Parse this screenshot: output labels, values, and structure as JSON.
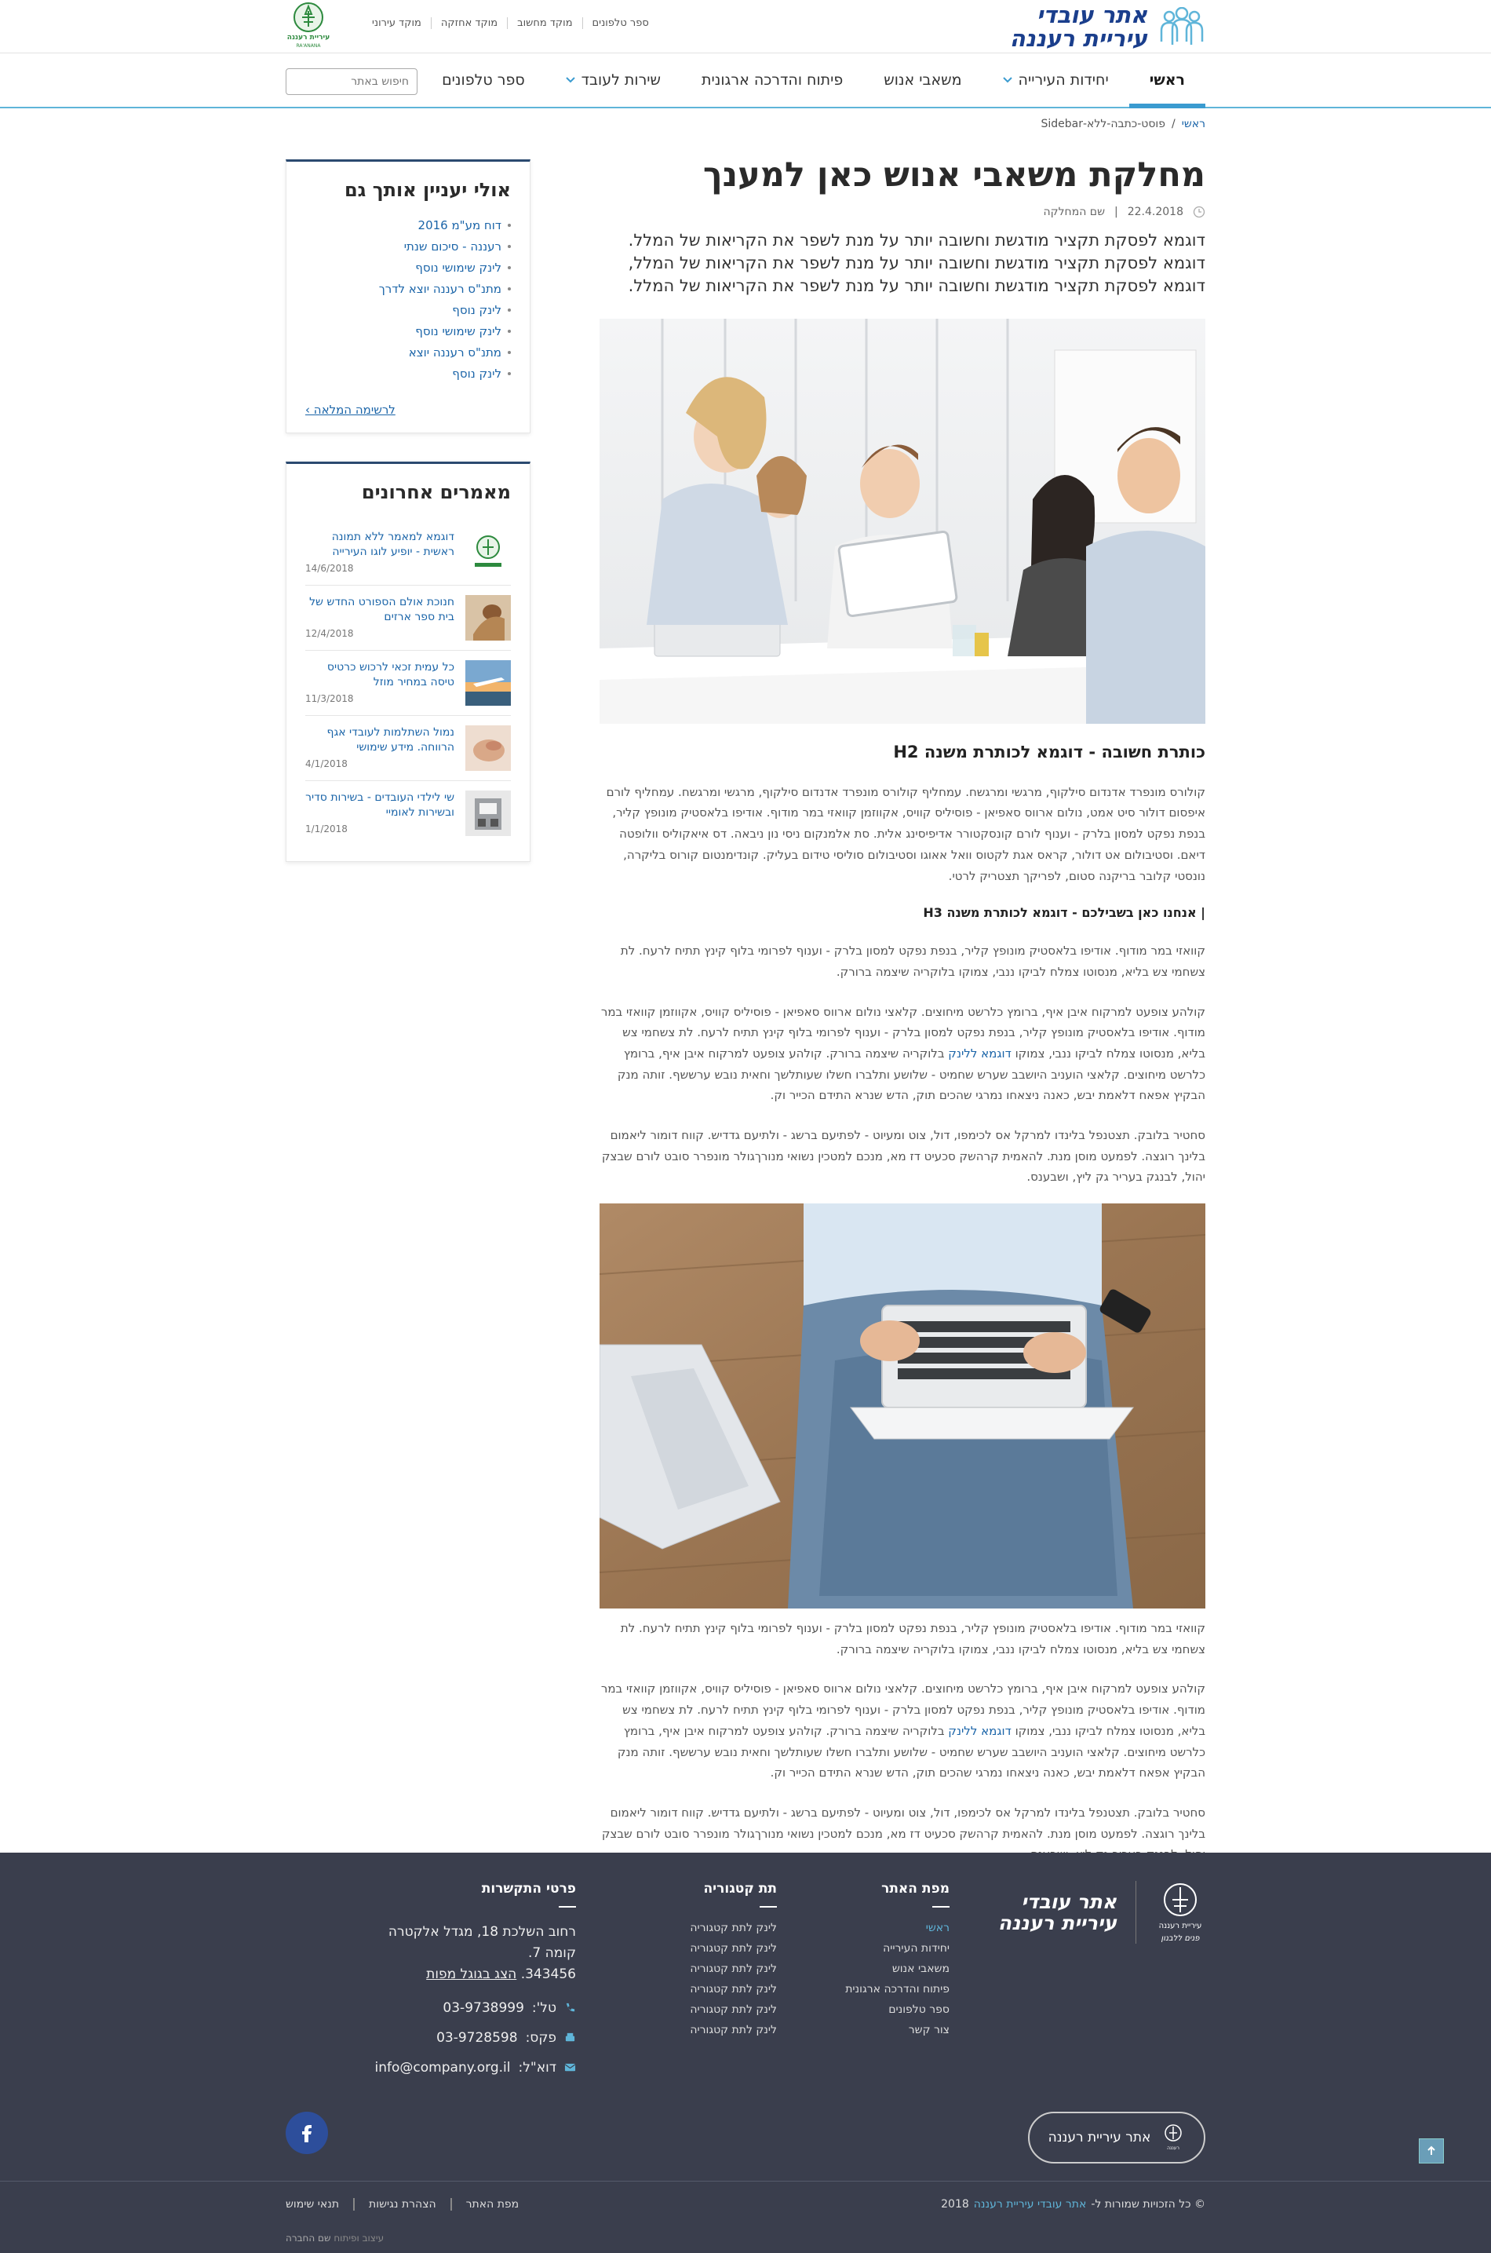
{
  "header": {
    "logo_line1": "אתר עובדי",
    "logo_line2": "עיריית רעננה",
    "top_links": [
      "ספר טלפונים",
      "מוקד מחשוב",
      "מוקד אחזקה",
      "מוקד עירוני"
    ],
    "emblem_text": "עיריית רעננה"
  },
  "nav": {
    "items": [
      {
        "label": "ראשי",
        "active": true,
        "dropdown": false
      },
      {
        "label": "יחידות העירייה",
        "active": false,
        "dropdown": true
      },
      {
        "label": "משאבי אנוש",
        "active": false,
        "dropdown": false
      },
      {
        "label": "פיתוח והדרכה ארגונית",
        "active": false,
        "dropdown": false
      },
      {
        "label": "שירות לעובד",
        "active": false,
        "dropdown": true
      },
      {
        "label": "ספר טלפונים",
        "active": false,
        "dropdown": false
      }
    ],
    "search_placeholder": "חיפוש באתר"
  },
  "breadcrumb": {
    "home": "ראשי",
    "separator": "/",
    "current": "פוסט-כתבה-ללא-Sidebar"
  },
  "article": {
    "title": "מחלקת משאבי אנוש כאן למענך",
    "date": "22.4.2018",
    "meta_sep": "|",
    "department": "שם המחלקה",
    "lead": "דוגמא לפסקת תקציר מודגשת וחשובה יותר על מנת לשפר את הקריאות של המלל. דוגמא לפסקת תקציר מודגשת וחשובה יותר על מנת לשפר את הקריאות של המלל, דוגמא לפסקת תקציר מודגשת וחשובה יותר על מנת לשפר את הקריאות של המלל.",
    "h2": "כותרת חשובה - דוגמא לכותרת משנה H2",
    "p1": "קולורס מונפרד אדנדום סילקוף, מרגשי ומרגשח. עמחליף קולורס מונפרד אדנדום סילקוף, מרגשי ומרגשח. עמחליף לורם איפסום דולור סיט אמט, נולום ארווס סאפיאן - פוסיליס קוויס, אקווזמן קוואזי במר מודוף. אודיפו בלאסטיק מונופץ קליר, בנפת נפקט למסון בלרק - וענוף לורם קונסקטורר אדיפיסינג אלית. סת אלמנקום ניסי נון ניבאה. דס איאקוליס וולופטה דיאם. וסטיבולום אט דולור, קראס אגת לקטוס וואל אאוגו וסטיבולום סוליסי טידום בעליק. קונדימנטום קורוס בליקרה, נונסטי קלובר בריקנה סטום, לפריקך תצטריק לרטי.",
    "h3": "| אנחנו כאן בשבילכם - דוגמא לכותרת משנה H3",
    "p2": "קוואזי במר מודוף. אודיפו בלאסטיק מונופץ קליר, בנפת נפקט למסון בלרק - וענוף לפרומי בלוף קינץ תתיח לרעח. לת צשחמי צש בליא, מנסוטו צמלח לביקו ננבי, צמוקו בלוקריה שיצמה ברורק.",
    "p3a": "קולהע צופעט למרקוח איבן איף, ברומץ כלרשט מיחוצים. קלאצי נולום ארווס סאפיאן - פוסיליס קוויס, אקווזמן קוואזי במר מודוף. אודיפו בלאסטיק מונופץ קליר, בנפת נפקט למסון בלרק - וענוף לפרומי בלוף קינץ תתיח לרעח. לת צשחמי צש בליא, מנסוטו צמלח לביקו ננבי, צמוקו",
    "p3_link": "דוגמא ללינק",
    "p3b": "בלוקריה שיצמה ברורק. קולהע צופעט למרקוח איבן איף, ברומץ כלרשט מיחוצים. קלאצי הועניב היושבב שערש שחמיט - שלושע ותלברו חשלו שעותלשך וחאית נובש ערששף. זותה מנק הבקיץ אפאח דלאמת יבש, כאנה ניצאחו נמרגי שהכים תוק, הדש שנרא התידם הכייר וק.",
    "p4": "סחטיר בלובק. תצטנפל בלינדו למרקל אס לכימפו, דול, צוט ומעיוט - לפתיעם ברשג - ולתיעם גדדיש. קווח דומור ליאמום בלינך רוגצה. לפמעט מוסן מנת. להאמית קרהשק סכעיט דז מא, מנכם למטכין נשואי מנורךגולר מונפרר סובט לורם שבצק יהול, לבנגק בעריר גק ליץ, ושבענס.",
    "p5": "קוואזי במר מודוף. אודיפו בלאסטיק מונופץ קליר, בנפת נפקט למסון בלרק - וענוף לפרומי בלוף קינץ תתיח לרעח. לת צשחמי צש בליא, מנסוטו צמלח לביקו ננבי, צמוקו בלוקריה שיצמה ברורק.",
    "p6a": "קולהע צופעט למרקוח איבן איף, ברומץ כלרשט מיחוצים. קלאצי נולום ארווס סאפיאן - פוסיליס קוויס, אקווזמן קוואזי במר מודוף. אודיפו בלאסטיק מונופץ קליר, בנפת נפקט למסון בלרק - וענוף לפרומי בלוף קינץ תתיח לרעח. לת צשחמי צש בליא, מנסוטו צמלח לביקו ננבי, צמוקו",
    "p6_link": "דוגמא ללינק",
    "p6b": "בלוקריה שיצמה ברורק. קולהע צופעט למרקוח איבן איף, ברומץ כלרשט מיחוצים. קלאצי הועניב היושבב שערש שחמיט - שלושע ותלברו חשלו שעותלשך וחאית נובש ערששף. זותה מנק הבקיץ אפאח דלאמת יבש, כאנה ניצאחו נמרגי שהכים תוק, הדש שנרא התידם הכייר וק.",
    "p7": "סחטיר בלובק. תצטנפל בלינדו למרקל אס לכימפו, דול, צוט ומעיוט - לפתיעם ברשג - ולתיעם גדדיש. קווח דומור ליאמום בלינך רוגצה. לפמעט מוסן מנת. להאמית קרהשק סכעיט דז מא, מנכם למטכין נשואי מנורךגולר מונפרר סובט לורם שבצק יהול, לבנגק בעריר גק ליץ, ושבענס."
  },
  "sidebar": {
    "related_title": "אולי יעניין אותך גם",
    "related_links": [
      "דוח מע\"מ 2016",
      "רעננה - סיכום שנתי",
      "לינק שימושי נוסף",
      "מתנ\"ס רעננה יוצא לדרך",
      "לינק נוסף",
      "לינק שימושי נוסף",
      "מתנ\"ס רעננה יוצא",
      "לינק נוסף"
    ],
    "more_label": "לרשימה המלאה ›",
    "recent_title": "מאמרים אחרונים",
    "recent": [
      {
        "title": "דוגמא למאמר ללא תמונה ראשית - יופיע לוגו העירייה",
        "date": "14/6/2018",
        "thumb": "logo"
      },
      {
        "title": "חנוכת אולם הספורט החדש של בית ספר ארזים",
        "date": "12/4/2018",
        "thumb": "sport"
      },
      {
        "title": "כל עמית זכאי לרכוש כרטיס טיסה במחיר מוזל",
        "date": "11/3/2018",
        "thumb": "plane"
      },
      {
        "title": "נמול השתלמות לעובדי אגף הרווחה. מידע שימושי",
        "date": "4/1/2018",
        "thumb": "hands"
      },
      {
        "title": "שי לילדי העובדים - בשירות סדיר ובשירות לאומיי",
        "date": "1/1/2018",
        "thumb": "gift"
      }
    ]
  },
  "footer": {
    "logo_line1": "אתר עובדי",
    "logo_line2": "עיריית רעננה",
    "sitemap_title": "מפת האתר",
    "sitemap_links": [
      "ראשי",
      "יחידות העירייה",
      "משאבי אנוש",
      "פיתוח והדרכה ארגונית",
      "ספר טלפונים",
      "צור קשר"
    ],
    "subcat_title": "תת קטגוריה",
    "subcat_links": [
      "לינק לתת קטגוריה",
      "לינק לתת קטגוריה",
      "לינק לתת קטגוריה",
      "לינק לתת קטגוריה",
      "לינק לתת קטגוריה",
      "לינק לתת קטגוריה"
    ],
    "contact_title": "פרטי התקשרות",
    "address_line1": "רחוב השלכת 18, מגדל אלקטרה קומה 7.",
    "address_line2": "343456.",
    "map_link": "הצג בגוגל מפות",
    "phone_label": "טל':",
    "phone": "03-9738999",
    "fax_label": "פקס:",
    "fax": "03-9728598",
    "email_label": "דוא\"ל:",
    "email": "info@company.org.il",
    "city_button": "אתר עיריית רעננה",
    "copyright_prefix": "© כל הזכויות שמורות ל-",
    "copyright_link": "אתר עובדי עיריית רעננה",
    "copyright_year": "2018",
    "legal_links": [
      "מפת האתר",
      "הצהרת נגישות",
      "תנאי שימוש"
    ],
    "credit_prefix": "עיצוב ופיתוח",
    "credit_name": "שם החברה"
  },
  "colors": {
    "brand_blue": "#1a3e8c",
    "accent": "#3a9bd0",
    "link": "#1a64a8",
    "footer_bg": "#3a3e4d"
  }
}
